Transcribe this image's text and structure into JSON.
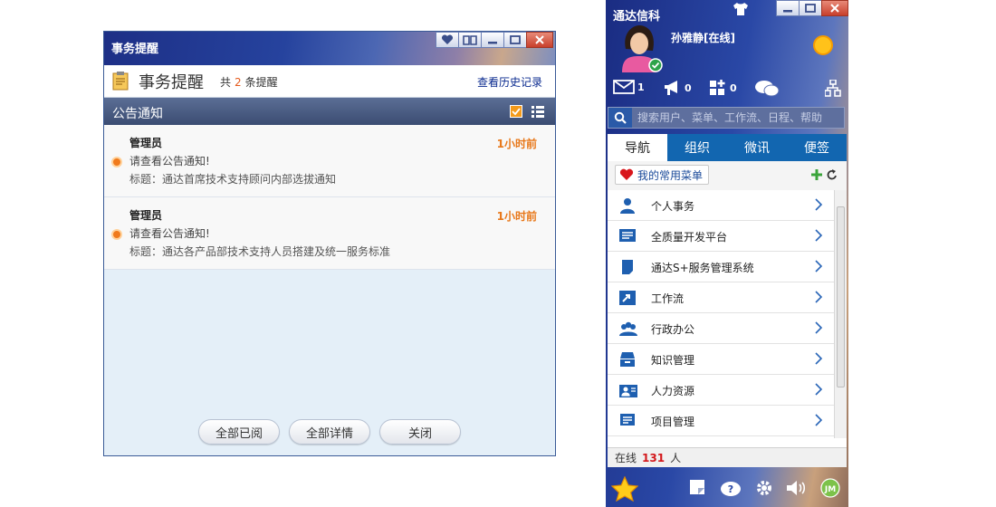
{
  "reminder": {
    "window_title": "事务提醒",
    "header_title": "事务提醒",
    "count_prefix": "共",
    "count": "2",
    "count_suffix": "条提醒",
    "history_link": "查看历史记录",
    "section_label": "公告通知",
    "notices": [
      {
        "sender": "管理员",
        "time": "1小时前",
        "message": "请查看公告通知!",
        "subject": "标题：通达首席技术支持顾问内部选拔通知"
      },
      {
        "sender": "管理员",
        "time": "1小时前",
        "message": "请查看公告通知!",
        "subject": "标题：通达各产品部技术支持人员搭建及统一服务标准"
      }
    ],
    "buttons": {
      "mark_all_read": "全部已阅",
      "all_details": "全部详情",
      "close": "关闭"
    }
  },
  "client": {
    "window_title": "通达信科",
    "user": {
      "name": "孙雅静",
      "status": "[在线]"
    },
    "stats": {
      "mail": "1",
      "notice": "0",
      "apps": "0"
    },
    "search": {
      "placeholder": "搜索用户、菜单、工作流、日程、帮助"
    },
    "tabs": [
      "导航",
      "组织",
      "微讯",
      "便签"
    ],
    "favorites_label": "我的常用菜单",
    "menu": [
      {
        "label": "个人事务",
        "icon": "person-icon"
      },
      {
        "label": "全质量开发平台",
        "icon": "monitor-icon"
      },
      {
        "label": "通达S+服务管理系统",
        "icon": "document-icon"
      },
      {
        "label": "工作流",
        "icon": "workflow-icon"
      },
      {
        "label": "行政办公",
        "icon": "group-icon"
      },
      {
        "label": "知识管理",
        "icon": "archive-icon"
      },
      {
        "label": "人力资源",
        "icon": "hr-icon"
      },
      {
        "label": "项目管理",
        "icon": "project-icon"
      }
    ],
    "online": {
      "prefix": "在线",
      "count": "131",
      "suffix": "人"
    },
    "colors": {
      "tab_bar": "#1266b0",
      "accent_orange": "#e8781a",
      "online_count": "#d3181c"
    }
  }
}
